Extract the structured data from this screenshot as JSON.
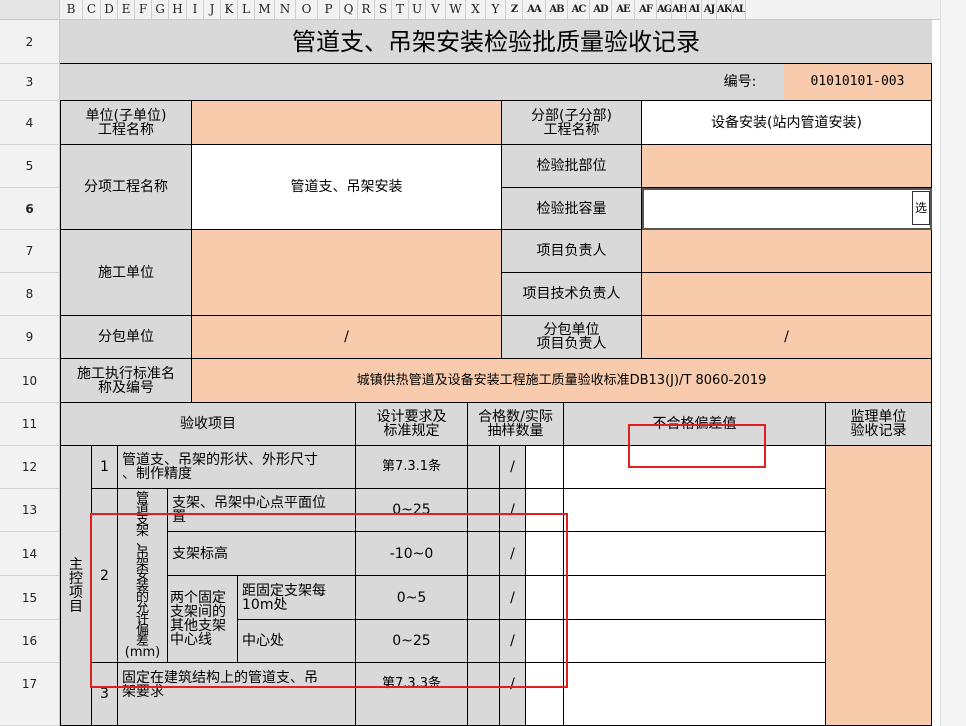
{
  "columns": [
    "B",
    "C",
    "D",
    "E",
    "F",
    "G",
    "H",
    "I",
    "J",
    "K",
    "L",
    "M",
    "N",
    "O",
    "P",
    "Q",
    "R",
    "S",
    "T",
    "U",
    "V",
    "W",
    "X",
    "Y",
    "Z",
    "AA",
    "AB",
    "AC",
    "AD",
    "AE",
    "AF",
    "AG",
    "AH",
    "AI",
    "AJ",
    "AK",
    "AL"
  ],
  "rows": [
    "2",
    "3",
    "4",
    "5",
    "6",
    "7",
    "8",
    "9",
    "10",
    "11",
    "12",
    "13",
    "14",
    "15",
    "16",
    "17"
  ],
  "sheet": {
    "title": "管道支、吊架安装检验批质量验收记录",
    "serial_label": "编号:",
    "serial_value": "01010101-003",
    "unit_label": "单位(子单位)\n工程名称",
    "division_label": "分部(子分部)\n工程名称",
    "division_value": "设备安装(站内管道安装)",
    "sub_item_label": "分项工程名称",
    "sub_item_value": "管道支、吊架安装",
    "batch_part_label": "检验批部位",
    "batch_capacity_label": "检验批容量",
    "select_button": "选",
    "contractor_label": "施工单位",
    "pm_label": "项目负责人",
    "tech_lead_label": "项目技术负责人",
    "subcontractor_label": "分包单位",
    "subcontractor_value": "/",
    "sub_pm_label": "分包单位\n项目负责人",
    "sub_pm_value": "/",
    "standard_label": "施工执行标准名\n称及编号",
    "standard_value": "城镇供热管道及设备安装工程施工质量验收标准DB13(J)/T 8060-2019",
    "hdr_item": "验收项目",
    "hdr_design": "设计要求及\n标准规定",
    "hdr_sample": "合格数/实际\n抽样数量",
    "hdr_deviation": "不合格偏差值",
    "hdr_supervisor": "监理单位\n验收记录",
    "main_control": "主\n控\n项\n目",
    "item1_no": "1",
    "item1_desc": "管道支、吊架的形状、外形尺寸\n、制作精度",
    "item1_std": "第7.3.1条",
    "item2_no": "2",
    "item2_group": "管\n道\n支\n架\n、\n吊\n架\n安\n装\n的\n允\n许\n偏\n差\n(mm)",
    "item2a_desc": "支架、吊架中心点平面位\n置",
    "item2a_std": "0~25",
    "item2b_desc": "支架标高",
    "item2b_std": "-10~0",
    "item2c_group": "两个固定\n支架间的\n其他支架\n中心线",
    "item2c1_desc": "距固定支架每\n10m处",
    "item2c1_std": "0~5",
    "item2c2_desc": "中心处",
    "item2c2_std": "0~25",
    "item3_no": "3",
    "item3_desc": "固定在建筑结构上的管道支、吊\n架要求",
    "item3_std": "第7.3.3条",
    "slash": "/"
  }
}
